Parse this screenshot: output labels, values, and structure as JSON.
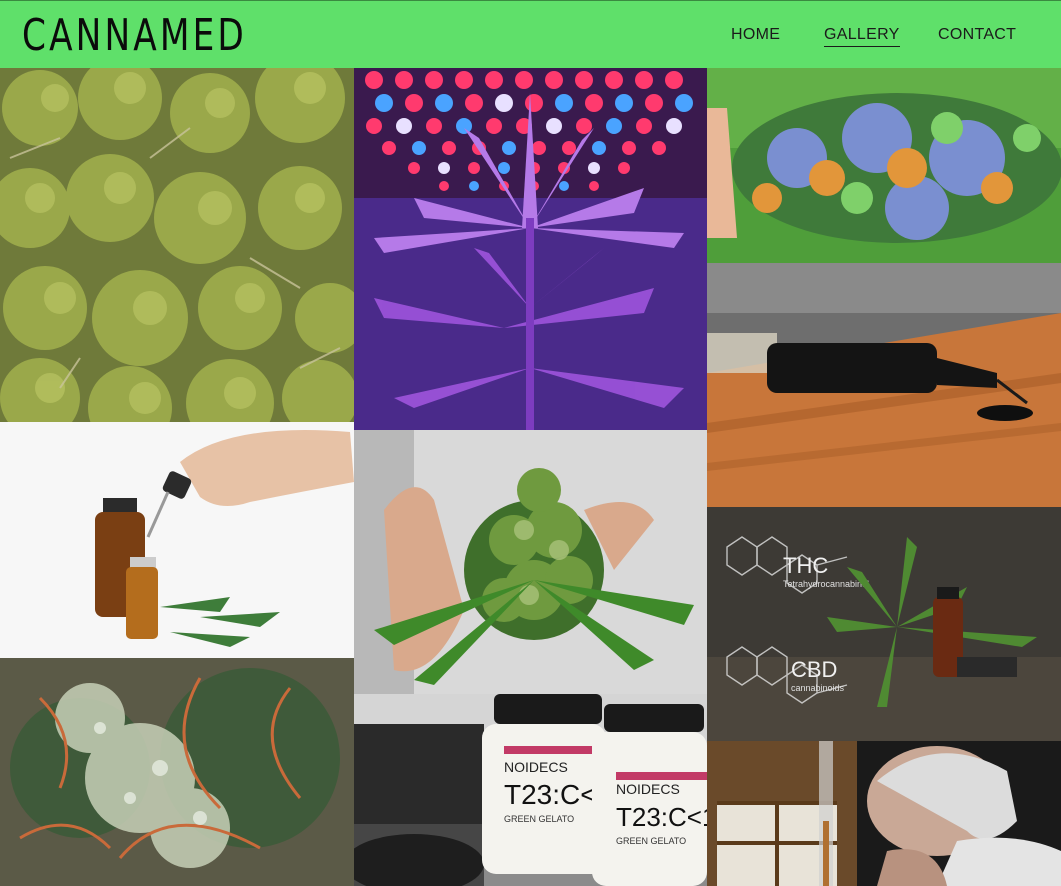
{
  "brand": {
    "logo_text": "CANNAMED"
  },
  "nav": {
    "items": [
      {
        "label": "HOME",
        "active": false
      },
      {
        "label": "GALLERY",
        "active": true
      },
      {
        "label": "CONTACT",
        "active": false
      }
    ]
  },
  "gallery": {
    "photos": [
      {
        "name": "dried-buds-pile-photo"
      },
      {
        "name": "led-grow-light-plant-photo"
      },
      {
        "name": "colorful-bud-closeup-photo"
      },
      {
        "name": "oil-syringe-on-wood-photo"
      },
      {
        "name": "dropper-oil-bottles-photo"
      },
      {
        "name": "hand-holding-flowering-plant-photo"
      },
      {
        "name": "thc-cbd-molecules-photo",
        "labels": {
          "thc": "THC",
          "thc_sub": "Tetrahydrocannabinol",
          "cbd": "CBD",
          "cbd_sub": "cannabinoids"
        }
      },
      {
        "name": "trichome-macro-photo"
      },
      {
        "name": "jars-product-photo",
        "labels": {
          "brand": "NOIDECS",
          "code": "T23:C<1",
          "strain": "GREEN GELATO"
        }
      },
      {
        "name": "man-inhaling-vapor-photo"
      }
    ]
  },
  "colors": {
    "header_bg": "#5fe06a",
    "text": "#111111"
  }
}
